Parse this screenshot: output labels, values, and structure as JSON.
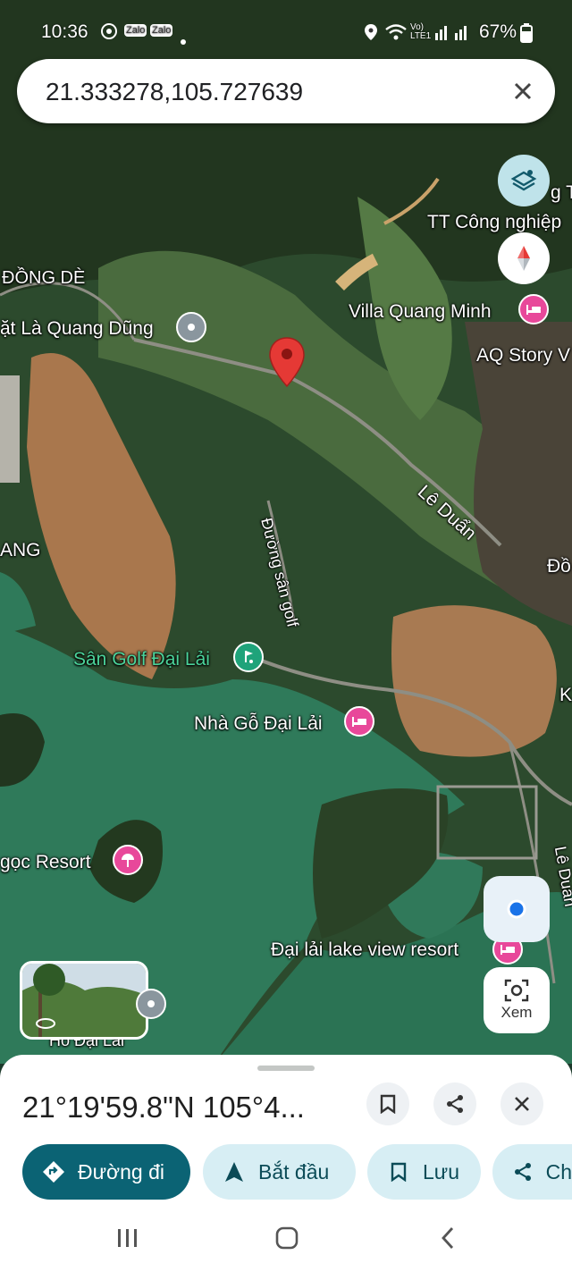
{
  "status_bar": {
    "time": "10:36",
    "notif_icons": [
      "chrome-icon",
      "zalo-icon",
      "zalo-icon",
      "dot-icon"
    ],
    "zalo_label": "Zalo",
    "network": "Vo) LTE1",
    "battery": "67%"
  },
  "search": {
    "query": "21.333278,105.727639",
    "close_icon": "close-icon"
  },
  "map": {
    "labels": {
      "dong_de": "ĐỒNG DÈ",
      "quang_dung": "ặt Là Quang Dũng",
      "tt_cong_nghiep": "TT Công nghiệp",
      "g_ty": "g Ty",
      "villa": "Villa Quang Minh",
      "aq_story": "AQ Story V",
      "le_duan": "Lê Duẩn",
      "duong_san_golf": "Đường sân golf",
      "ang": "ANG",
      "san_golf": "Sân Golf Đại Lải",
      "nha_go": "Nhà Gỗ Đại Lải",
      "ngoc_resort": "gọc Resort",
      "lake_view": "Đại lải lake view resort",
      "ho_dai_lai": "Hồ Đại Lải",
      "le_duan_2": "Lê Duẩn",
      "do_edge": "Đồ",
      "k_edge": "K"
    },
    "colors": {
      "pin": "#e53935",
      "hotel": "#e8489a",
      "golf": "#1fa37a",
      "accent": "#1a73e8"
    }
  },
  "controls": {
    "layers_icon": "layers-icon",
    "compass_icon": "compass-icon",
    "location_icon": "my-location-icon",
    "view_label": "Xem",
    "view_icon": "lens-icon"
  },
  "sheet": {
    "coords": "21°19'59.8\"N 105°4...",
    "save_icon": "bookmark-icon",
    "share_icon": "share-icon",
    "close_icon": "close-icon",
    "chips": [
      {
        "label": "Đường đi",
        "icon": "directions-icon"
      },
      {
        "label": "Bắt đầu",
        "icon": "navigation-icon"
      },
      {
        "label": "Lưu",
        "icon": "bookmark-icon"
      },
      {
        "label": "Ch",
        "icon": "share-icon"
      }
    ]
  },
  "navbar": {
    "recent": "recents-icon",
    "home": "home-icon",
    "back": "back-icon"
  }
}
